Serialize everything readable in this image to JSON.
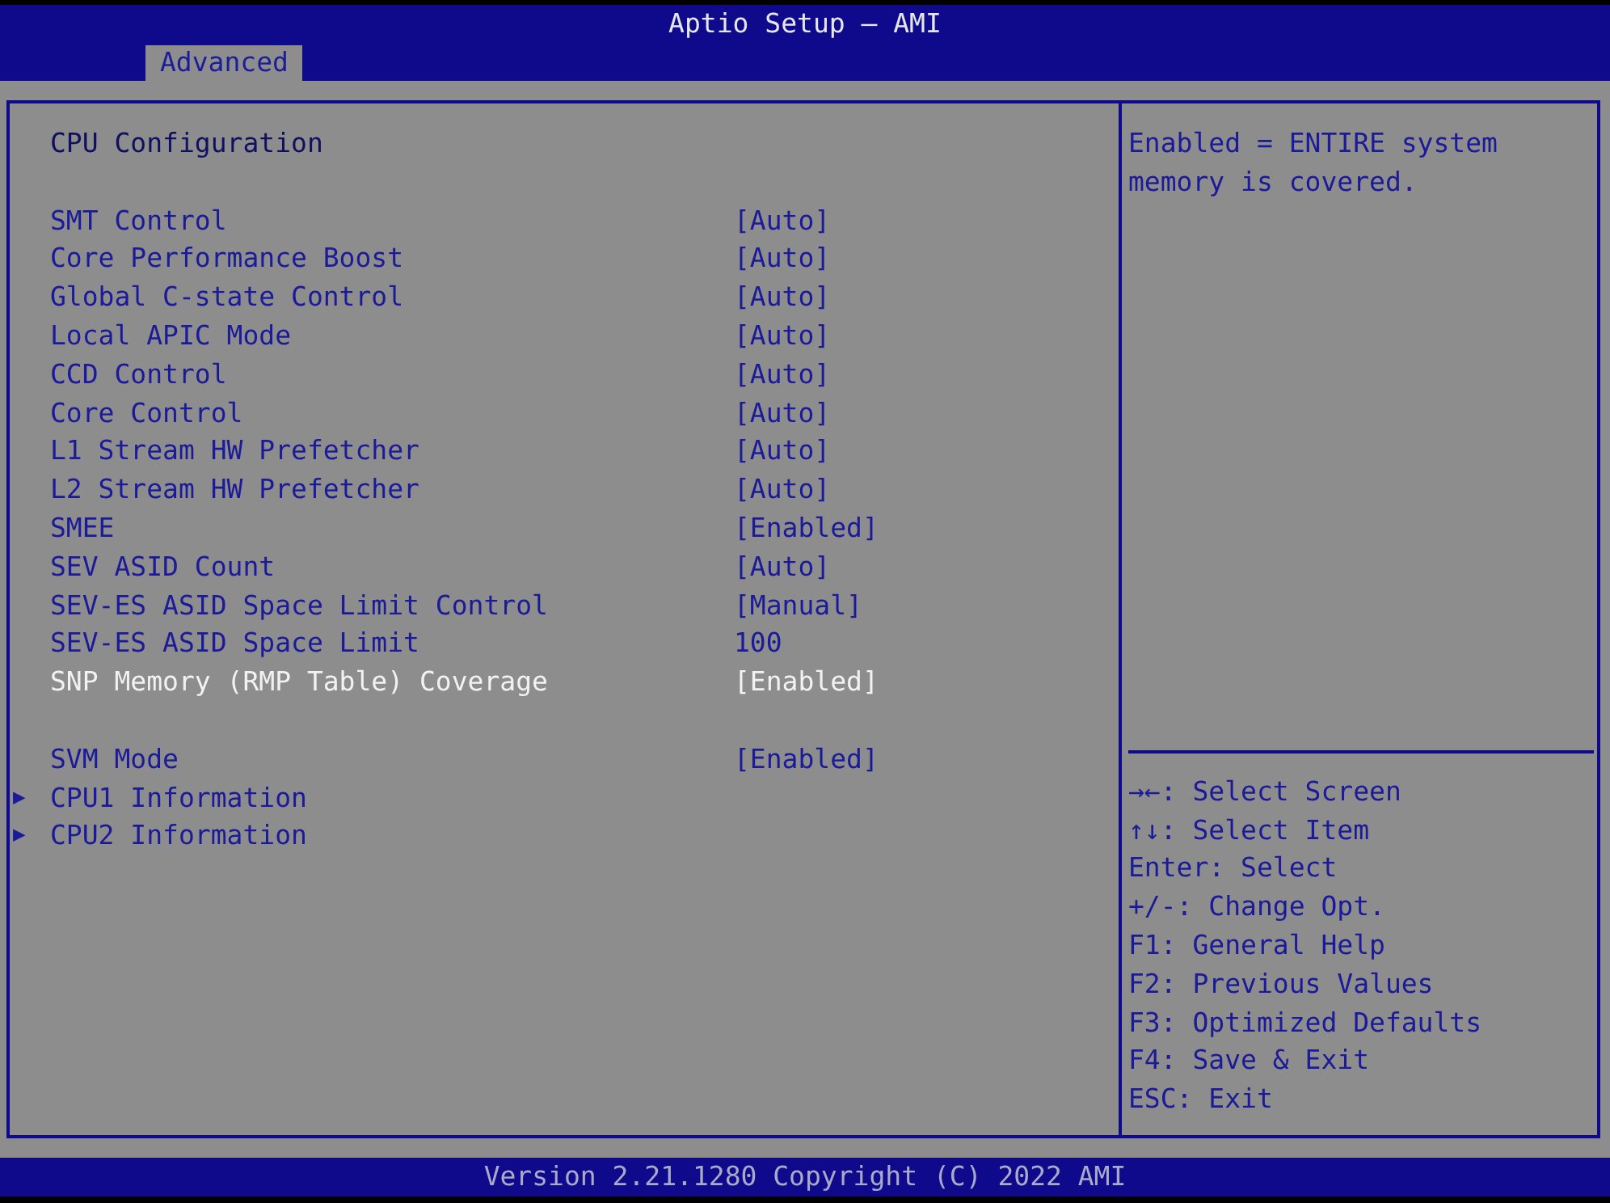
{
  "window": {
    "title": "Aptio Setup – AMI"
  },
  "tabs": [
    {
      "label": "Advanced",
      "selected": true
    }
  ],
  "page": {
    "title": "CPU Configuration",
    "groups": [
      [
        {
          "kind": "setting",
          "label": "SMT Control",
          "value": "[Auto]",
          "selected": false
        },
        {
          "kind": "setting",
          "label": "Core Performance Boost",
          "value": "[Auto]",
          "selected": false
        },
        {
          "kind": "setting",
          "label": "Global C-state Control",
          "value": "[Auto]",
          "selected": false
        },
        {
          "kind": "setting",
          "label": "Local APIC Mode",
          "value": "[Auto]",
          "selected": false
        },
        {
          "kind": "setting",
          "label": "CCD Control",
          "value": "[Auto]",
          "selected": false
        },
        {
          "kind": "setting",
          "label": "Core Control",
          "value": "[Auto]",
          "selected": false
        },
        {
          "kind": "setting",
          "label": "L1 Stream HW Prefetcher",
          "value": "[Auto]",
          "selected": false
        },
        {
          "kind": "setting",
          "label": "L2 Stream HW Prefetcher",
          "value": "[Auto]",
          "selected": false
        },
        {
          "kind": "setting",
          "label": "SMEE",
          "value": "[Enabled]",
          "selected": false
        },
        {
          "kind": "setting",
          "label": "SEV ASID Count",
          "value": "[Auto]",
          "selected": false
        },
        {
          "kind": "setting",
          "label": "SEV-ES ASID Space Limit Control",
          "value": "[Manual]",
          "selected": false
        },
        {
          "kind": "setting",
          "label": "SEV-ES ASID Space Limit",
          "value": "100",
          "selected": false
        },
        {
          "kind": "setting",
          "label": "SNP Memory (RMP Table) Coverage",
          "value": "[Enabled]",
          "selected": true
        }
      ],
      [
        {
          "kind": "setting",
          "label": "SVM Mode",
          "value": "[Enabled]",
          "selected": false
        },
        {
          "kind": "submenu",
          "label": "CPU1 Information",
          "arrow": "▶",
          "selected": false
        },
        {
          "kind": "submenu",
          "label": "CPU2 Information",
          "arrow": "▶",
          "selected": false
        }
      ]
    ]
  },
  "help": {
    "text": "Enabled = ENTIRE system memory is covered."
  },
  "keys": [
    "→←: Select Screen",
    "↑↓: Select Item",
    "Enter: Select",
    "+/-: Change Opt.",
    "F1: General Help",
    "F2: Previous Values",
    "F3: Optimized Defaults",
    "F4: Save & Exit",
    "ESC: Exit"
  ],
  "status_bar": {
    "text": "Version 2.21.1280 Copyright (C) 2022 AMI"
  }
}
